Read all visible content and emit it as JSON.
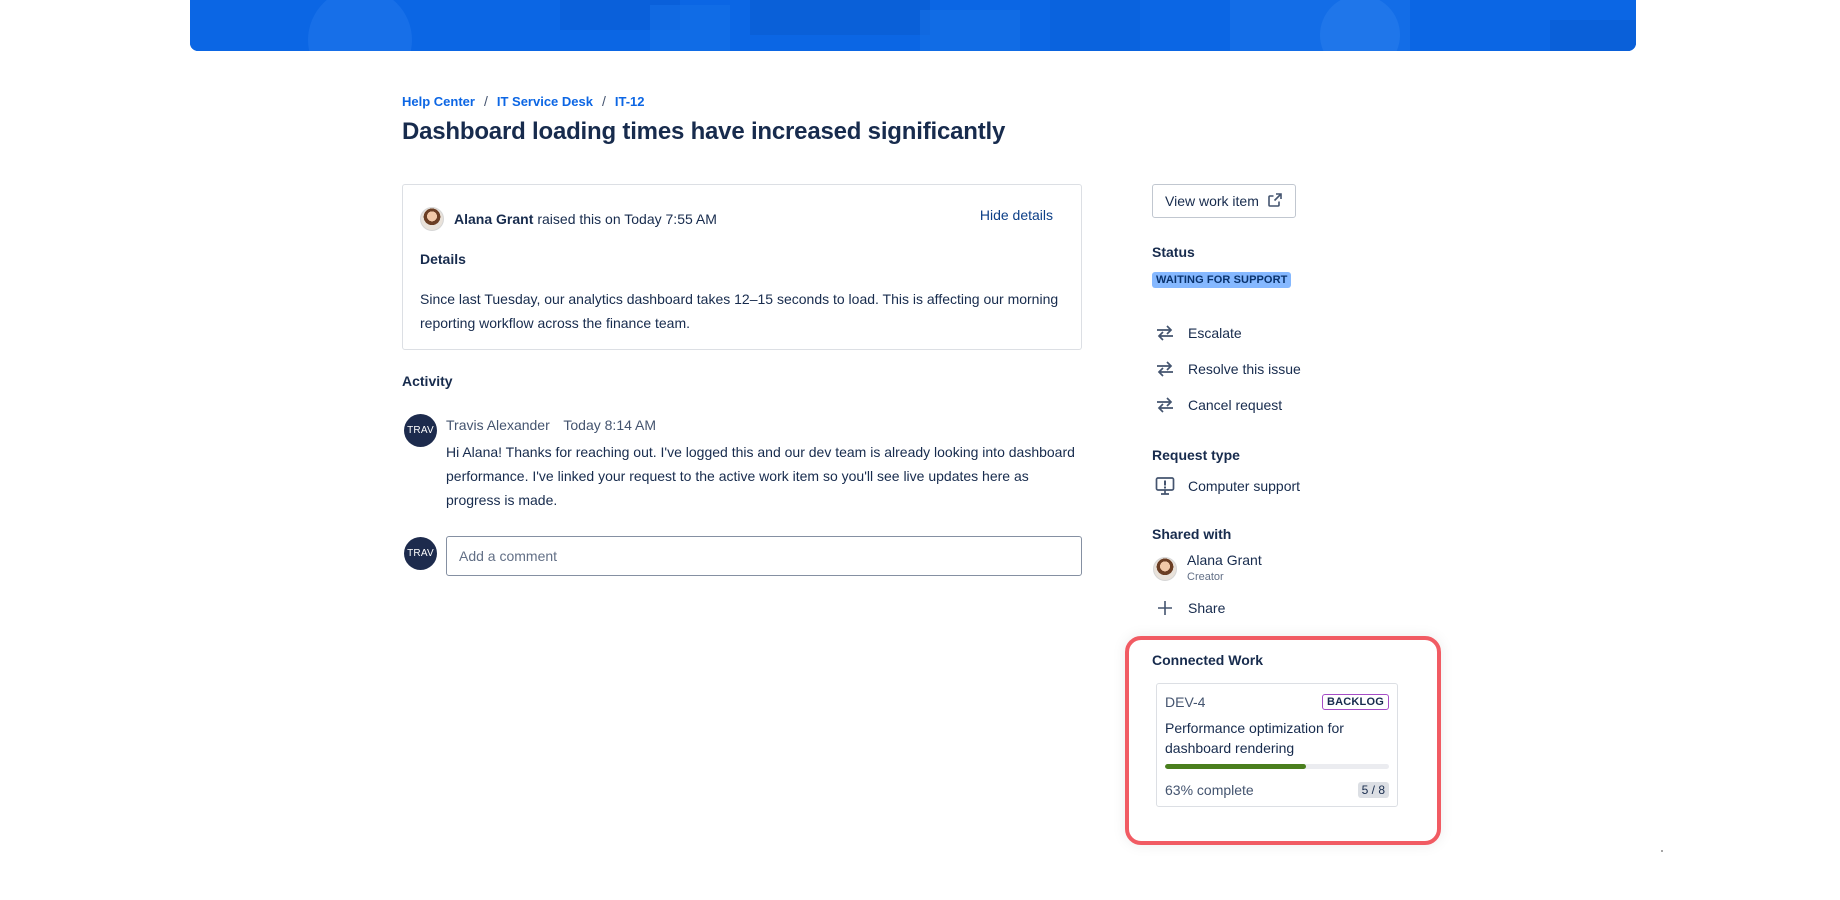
{
  "breadcrumb": {
    "items": [
      "Help Center",
      "IT Service Desk",
      "IT-12"
    ],
    "separator": "/"
  },
  "page_title": "Dashboard loading times have increased significantly",
  "details_card": {
    "reporter": "Alana Grant",
    "raised_text": "raised this on Today 7:55 AM",
    "hide_label": "Hide details",
    "details_heading": "Details",
    "details_text": "Since last Tuesday, our analytics dashboard takes 12–15 seconds to load. This is affecting our morning reporting workflow across the finance team."
  },
  "activity": {
    "heading": "Activity",
    "comment": {
      "avatar_initials": "TRAV",
      "author": "Travis Alexander",
      "timestamp": "Today 8:14 AM",
      "text": "Hi Alana! Thanks for reaching out. I've logged this and our dev team is already looking into dashboard performance. I've linked your request to the active work item so you'll see live updates here as progress is made."
    },
    "composer": {
      "avatar_initials": "TRAV",
      "placeholder": "Add a comment"
    }
  },
  "sidebar": {
    "view_work_item_label": "View work item",
    "status_heading": "Status",
    "status_value": "WAITING FOR SUPPORT",
    "actions": [
      "Escalate",
      "Resolve this issue",
      "Cancel request"
    ],
    "request_type_heading": "Request type",
    "request_type_value": "Computer support",
    "shared_with_heading": "Shared with",
    "shared_user_name": "Alana Grant",
    "shared_user_role": "Creator",
    "share_label": "Share"
  },
  "connected_work": {
    "heading": "Connected Work",
    "key": "DEV-4",
    "status": "BACKLOG",
    "title": "Performance optimization for dashboard rendering",
    "progress_fraction": 0.63,
    "complete_text": "63% complete",
    "count_text": "5 / 8"
  },
  "colors": {
    "banner": "#0b66e4",
    "link": "#0c66e4",
    "status_lozenge_bg": "#85b8ff",
    "progress_fill": "#4a7f1e",
    "highlight_border": "#f15b63"
  }
}
